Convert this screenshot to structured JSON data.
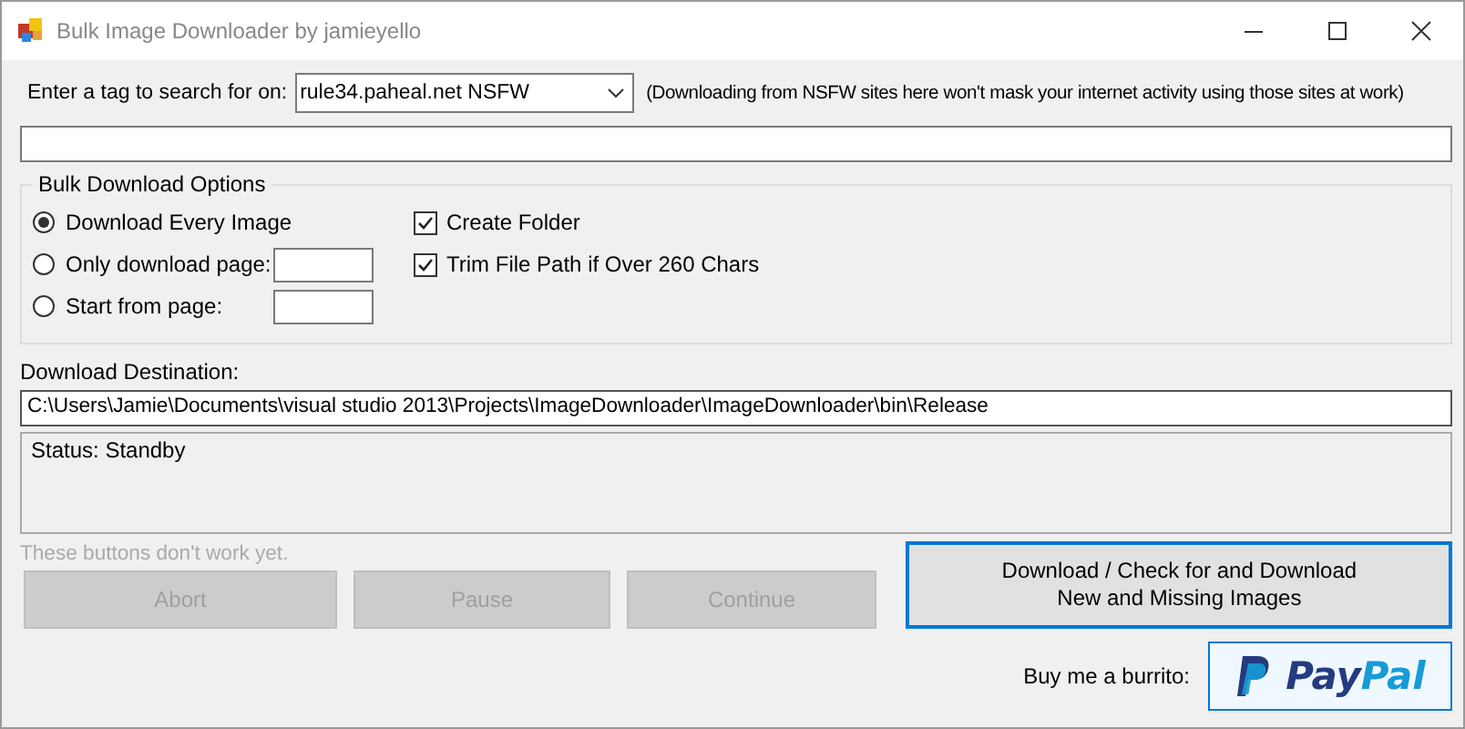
{
  "window": {
    "title": "Bulk Image Downloader by jamieyello"
  },
  "search": {
    "label": "Enter a tag to search for on:",
    "site": "rule34.paheal.net NSFW",
    "note": "(Downloading from NSFW sites here won't mask your internet activity using those sites at work)"
  },
  "options": {
    "title": "Bulk Download Options",
    "radios": [
      {
        "label": "Download Every Image",
        "selected": true,
        "field": false
      },
      {
        "label": "Only download page:",
        "selected": false,
        "field": true
      },
      {
        "label": "Start from page:",
        "selected": false,
        "field": true
      }
    ],
    "checkboxes": [
      {
        "label": "Create Folder",
        "checked": true
      },
      {
        "label": "Trim File Path if Over 260 Chars",
        "checked": true
      }
    ]
  },
  "destination": {
    "label": "Download Destination:",
    "value": "C:\\Users\\Jamie\\Documents\\visual studio 2013\\Projects\\ImageDownloader\\ImageDownloader\\bin\\Release"
  },
  "status": "Status: Standby",
  "buttons_hint": "These buttons don't work yet.",
  "buttons": [
    {
      "label": "Abort",
      "disabled": true
    },
    {
      "label": "Pause",
      "disabled": true
    },
    {
      "label": "Continue",
      "disabled": true
    }
  ],
  "main_button": {
    "lines": [
      "Download / Check for and Download",
      "New and Missing Images"
    ]
  },
  "donate": {
    "label": "Buy me a burrito:",
    "logo_parts": [
      "Pay",
      "Pal"
    ]
  }
}
